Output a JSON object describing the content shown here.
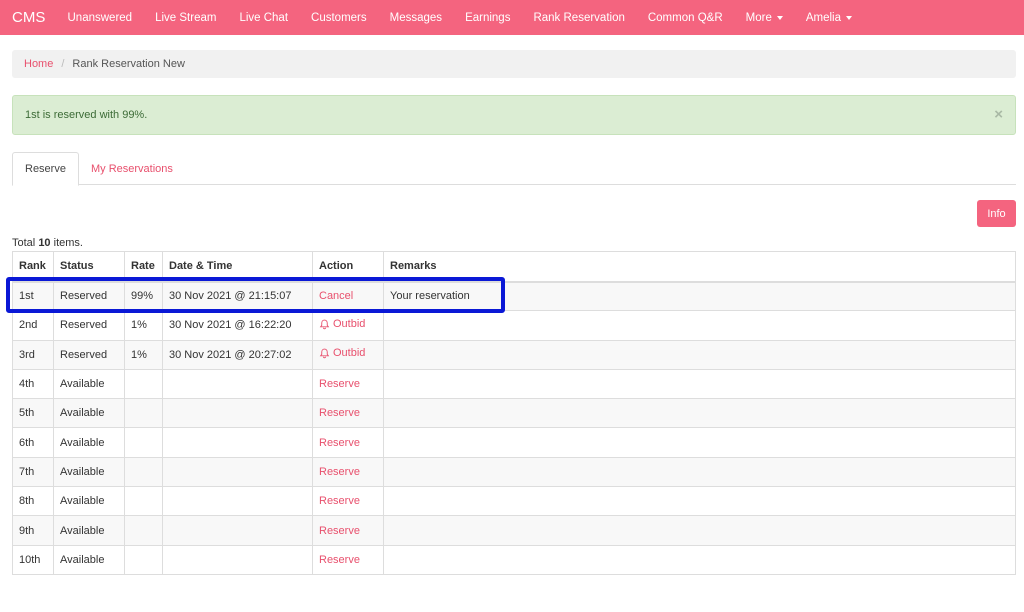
{
  "navbar": {
    "brand": "CMS",
    "items": [
      {
        "label": "Unanswered"
      },
      {
        "label": "Live Stream"
      },
      {
        "label": "Live Chat"
      },
      {
        "label": "Customers"
      },
      {
        "label": "Messages"
      },
      {
        "label": "Earnings"
      },
      {
        "label": "Rank Reservation"
      },
      {
        "label": "Common Q&R"
      },
      {
        "label": "More"
      },
      {
        "label": "Amelia"
      }
    ],
    "color": "#f4647f"
  },
  "breadcrumb": {
    "home": "Home",
    "separator": "/",
    "current": "Rank Reservation New"
  },
  "alert": {
    "message": "1st is reserved with 99%.",
    "close": "×"
  },
  "tabs": [
    {
      "label": "Reserve"
    },
    {
      "label": "My Reservations"
    }
  ],
  "info_button": "Info",
  "summary": {
    "prefix": "Total",
    "count": "10",
    "suffix": "items."
  },
  "table": {
    "headers": {
      "rank": "Rank",
      "status": "Status",
      "rate": "Rate",
      "datetime": "Date & Time",
      "action": "Action",
      "remarks": "Remarks"
    },
    "rows": [
      {
        "rank": "1st",
        "status": "Reserved",
        "rate": "99%",
        "datetime": "30 Nov 2021 @ 21:15:07",
        "action": "Cancel",
        "remarks": "Your reservation"
      },
      {
        "rank": "2nd",
        "status": "Reserved",
        "rate": "1%",
        "datetime": "30 Nov 2021 @ 16:22:20",
        "action": "Outbid",
        "remarks": ""
      },
      {
        "rank": "3rd",
        "status": "Reserved",
        "rate": "1%",
        "datetime": "30 Nov 2021 @ 20:27:02",
        "action": "Outbid",
        "remarks": ""
      },
      {
        "rank": "4th",
        "status": "Available",
        "rate": "",
        "datetime": "",
        "action": "Reserve",
        "remarks": ""
      },
      {
        "rank": "5th",
        "status": "Available",
        "rate": "",
        "datetime": "",
        "action": "Reserve",
        "remarks": ""
      },
      {
        "rank": "6th",
        "status": "Available",
        "rate": "",
        "datetime": "",
        "action": "Reserve",
        "remarks": ""
      },
      {
        "rank": "7th",
        "status": "Available",
        "rate": "",
        "datetime": "",
        "action": "Reserve",
        "remarks": ""
      },
      {
        "rank": "8th",
        "status": "Available",
        "rate": "",
        "datetime": "",
        "action": "Reserve",
        "remarks": ""
      },
      {
        "rank": "9th",
        "status": "Available",
        "rate": "",
        "datetime": "",
        "action": "Reserve",
        "remarks": ""
      },
      {
        "rank": "10th",
        "status": "Available",
        "rate": "",
        "datetime": "",
        "action": "Reserve",
        "remarks": ""
      }
    ]
  },
  "colors": {
    "accent": "#f4647f",
    "link": "#e8506d",
    "highlight": "#0a18d6",
    "alert_bg": "#dbedd3"
  }
}
